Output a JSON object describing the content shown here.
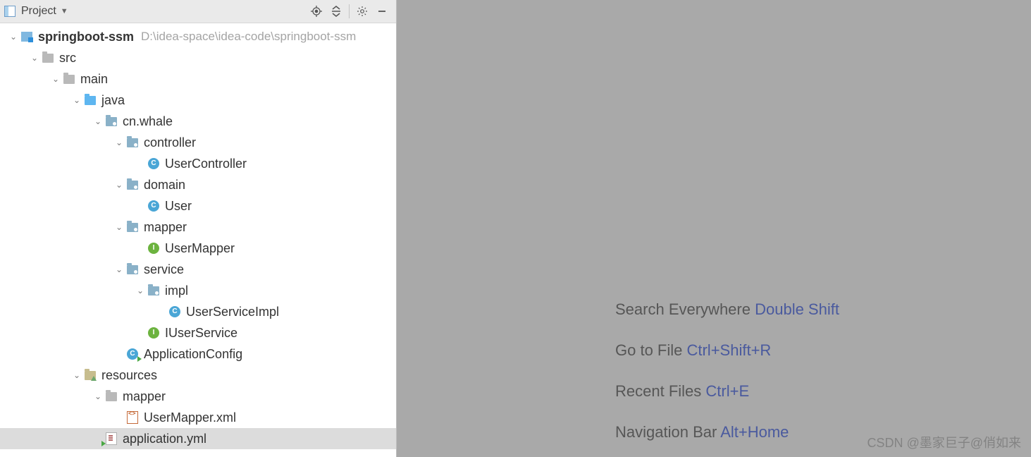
{
  "header": {
    "title": "Project"
  },
  "tree": [
    {
      "depth": 0,
      "expanded": true,
      "icon": "module",
      "label": "springboot-ssm",
      "bold": true,
      "path": "D:\\idea-space\\idea-code\\springboot-ssm"
    },
    {
      "depth": 1,
      "expanded": true,
      "icon": "folder",
      "label": "src"
    },
    {
      "depth": 2,
      "expanded": true,
      "icon": "folder",
      "label": "main"
    },
    {
      "depth": 3,
      "expanded": true,
      "icon": "folder-blue",
      "label": "java"
    },
    {
      "depth": 4,
      "expanded": true,
      "icon": "pkg",
      "label": "cn.whale"
    },
    {
      "depth": 5,
      "expanded": true,
      "icon": "pkg",
      "label": "controller"
    },
    {
      "depth": 6,
      "expanded": null,
      "icon": "class",
      "label": "UserController"
    },
    {
      "depth": 5,
      "expanded": true,
      "icon": "pkg",
      "label": "domain"
    },
    {
      "depth": 6,
      "expanded": null,
      "icon": "class",
      "label": "User"
    },
    {
      "depth": 5,
      "expanded": true,
      "icon": "pkg",
      "label": "mapper"
    },
    {
      "depth": 6,
      "expanded": null,
      "icon": "interface",
      "label": "UserMapper"
    },
    {
      "depth": 5,
      "expanded": true,
      "icon": "pkg",
      "label": "service"
    },
    {
      "depth": 6,
      "expanded": true,
      "icon": "pkg",
      "label": "impl"
    },
    {
      "depth": 7,
      "expanded": null,
      "icon": "class",
      "label": "UserServiceImpl"
    },
    {
      "depth": 6,
      "expanded": null,
      "icon": "interface",
      "label": "IUserService"
    },
    {
      "depth": 5,
      "expanded": null,
      "icon": "class-run",
      "label": "ApplicationConfig"
    },
    {
      "depth": 3,
      "expanded": true,
      "icon": "resources",
      "label": "resources"
    },
    {
      "depth": 4,
      "expanded": true,
      "icon": "folder",
      "label": "mapper"
    },
    {
      "depth": 5,
      "expanded": null,
      "icon": "xml",
      "label": "UserMapper.xml"
    },
    {
      "depth": 4,
      "expanded": null,
      "icon": "yml",
      "label": "application.yml",
      "selected": true
    }
  ],
  "hints": [
    {
      "text": "Search Everywhere",
      "shortcut": "Double Shift"
    },
    {
      "text": "Go to File",
      "shortcut": "Ctrl+Shift+R"
    },
    {
      "text": "Recent Files",
      "shortcut": "Ctrl+E"
    },
    {
      "text": "Navigation Bar",
      "shortcut": "Alt+Home"
    }
  ],
  "watermark": "CSDN @墨家巨子@俏如来"
}
